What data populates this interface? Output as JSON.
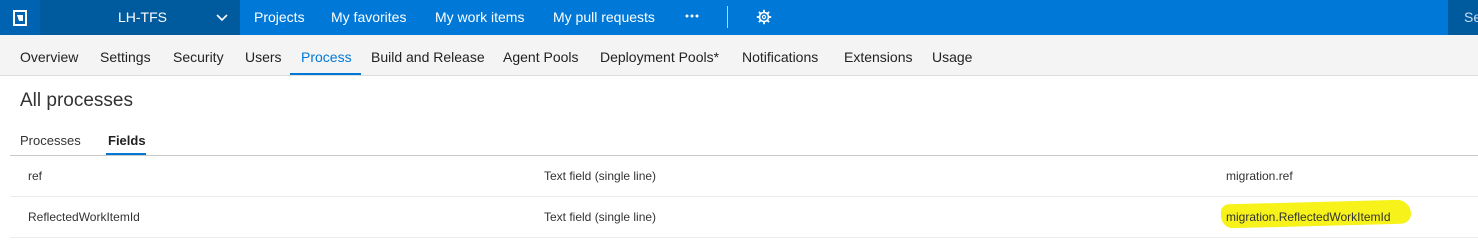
{
  "topbar": {
    "account_name": "LH-TFS",
    "nav": [
      "Projects",
      "My favorites",
      "My work items",
      "My pull requests"
    ],
    "search_text": "Se",
    "colors": {
      "bar": "#0078d7",
      "account_bg": "#005a9e",
      "logo_bg": "#0063b1"
    },
    "icons": [
      "vsts-logo-icon",
      "chevron-down-icon",
      "more-icon",
      "gear-icon"
    ]
  },
  "admin_tabs": {
    "items": [
      "Overview",
      "Settings",
      "Security",
      "Users",
      "Process",
      "Build and Release",
      "Agent Pools",
      "Deployment Pools*",
      "Notifications",
      "Extensions",
      "Usage"
    ],
    "active": "Process"
  },
  "page": {
    "title": "All processes",
    "subtabs": [
      "Processes",
      "Fields"
    ],
    "active_subtab": "Fields"
  },
  "fields_table": {
    "rows": [
      {
        "name": "ref",
        "type": "Text field (single line)",
        "reference": "migration.ref",
        "highlighted": false
      },
      {
        "name": "ReflectedWorkItemId",
        "type": "Text field (single line)",
        "reference": "migration.ReflectedWorkItemId",
        "highlighted": true
      }
    ]
  },
  "colors": {
    "accent": "#0078d7",
    "highlight": "#f6f21a"
  }
}
